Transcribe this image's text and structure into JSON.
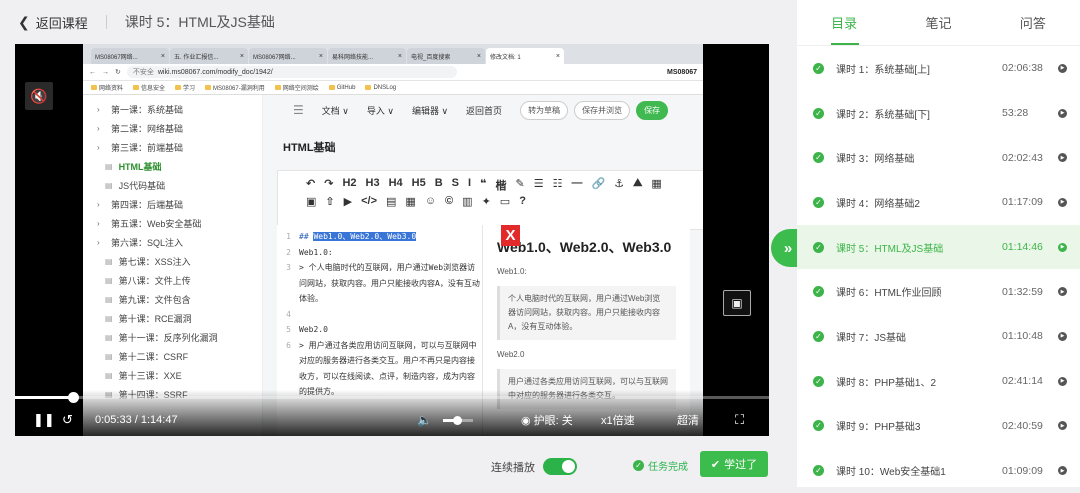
{
  "header": {
    "back_label": "返回课程",
    "lesson_title": "课时 5：HTML及JS基础"
  },
  "browser": {
    "tabs": [
      "MS08067网络...",
      "五. 作业汇报信...",
      "MS08067网络...",
      "易科网络技能...",
      "电视_百度搜索",
      "修改文档: 1"
    ],
    "url_warning": "不安全",
    "url": "wiki.ms08067.com/modify_doc/1942/",
    "bookmarks": [
      "网络资料",
      "信息安全",
      "学习",
      "MS08067-漏洞利用",
      "网络空间测绘",
      "GitHub",
      "DNSLog"
    ],
    "brand": "MS08067"
  },
  "doc_nav": [
    {
      "label": "第一课：系统基础",
      "type": "folder"
    },
    {
      "label": "第二课：网络基础",
      "type": "folder"
    },
    {
      "label": "第三课：前端基础",
      "type": "folder"
    },
    {
      "label": "HTML基础",
      "type": "current"
    },
    {
      "label": "JS代码基础",
      "type": "file"
    },
    {
      "label": "第四课：后端基础",
      "type": "folder"
    },
    {
      "label": "第五课：Web安全基础",
      "type": "folder"
    },
    {
      "label": "第六课：SQL注入",
      "type": "folder"
    },
    {
      "label": "第七课：XSS注入",
      "type": "file"
    },
    {
      "label": "第八课：文件上传",
      "type": "file"
    },
    {
      "label": "第九课：文件包含",
      "type": "file"
    },
    {
      "label": "第十课：RCE漏洞",
      "type": "file"
    },
    {
      "label": "第十一课：反序列化漏洞",
      "type": "file"
    },
    {
      "label": "第十二课：CSRF",
      "type": "file"
    },
    {
      "label": "第十三课：XXE",
      "type": "file"
    },
    {
      "label": "第十四课：SSRF",
      "type": "file"
    }
  ],
  "editor": {
    "menu": [
      "文档 ∨",
      "导入 ∨",
      "编辑器 ∨",
      "返回首页"
    ],
    "draft_label": "转为草稿",
    "save_preview_label": "保存并浏览",
    "save_label": "保存",
    "doc_title": "HTML基础",
    "toolbar_row1": [
      "↶",
      "↷",
      "H2",
      "H3",
      "H4",
      "H5",
      "B",
      "S",
      "I",
      "❝",
      "楷",
      "✎",
      "☰",
      "☷",
      "—",
      "🔗",
      "⚓",
      "⛰",
      "▦"
    ],
    "toolbar_row2": [
      "▣",
      "⇧",
      "▶",
      "</>",
      "▤",
      "▦",
      "☺",
      "©",
      "▥",
      "✦",
      "▭",
      "?"
    ],
    "code_lines": [
      {
        "n": "1",
        "pre": "## ",
        "sel": "Web1.0、Web2.0、Web3.0"
      },
      {
        "n": "2",
        "text": "Web1.0:"
      },
      {
        "n": "3",
        "text": "> 个人电脑时代的互联网，用户通过Web浏览器访问网站，获取内容。用户只能接收内容A，没有互动体验。",
        "green": true
      },
      {
        "n": "4",
        "text": ""
      },
      {
        "n": "5",
        "text": "Web2.0"
      },
      {
        "n": "6",
        "text": "> 用户通过各类应用访问互联网，可以与互联网中对应的服务器进行各类交互。用户不再只是内容接收方，可以在线阅读、点评，制造内容，成为内容的提供方。",
        "green": true
      }
    ],
    "preview_title": "Web1.0、Web2.0、Web3.0",
    "preview_p1": "Web1.0:",
    "preview_quote1": "个人电脑时代的互联网，用户通过Web浏览器访问网站，获取内容。用户只能接收内容A，没有互动体验。",
    "preview_p2": "Web2.0",
    "preview_quote2": "用户通过各类应用访问互联网，可以与互联网中对应的服务器进行各类交互。"
  },
  "player": {
    "progress_fraction": 0.077,
    "time": "0:05:33 / 1:14:47",
    "volume_fraction": 0.45,
    "eye_label": "护眼: 关",
    "speed_label": "x1倍速",
    "quality_label": "超清"
  },
  "bottom": {
    "autoplay_label": "连续播放",
    "task_done_label": "任务完成",
    "learned_label": "学过了"
  },
  "panel": {
    "tabs": [
      "目录",
      "笔记",
      "问答"
    ],
    "lessons": [
      {
        "title": "课时 1：系统基础[上]",
        "duration": "02:06:38"
      },
      {
        "title": "课时 2：系统基础[下]",
        "duration": "53:28"
      },
      {
        "title": "课时 3：网络基础",
        "duration": "02:02:43"
      },
      {
        "title": "课时 4：网络基础2",
        "duration": "01:17:09"
      },
      {
        "title": "课时 5：HTML及JS基础",
        "duration": "01:14:46",
        "current": true
      },
      {
        "title": "课时 6：HTML作业回顾",
        "duration": "01:32:59"
      },
      {
        "title": "课时 7：JS基础",
        "duration": "01:10:48"
      },
      {
        "title": "课时 8：PHP基础1、2",
        "duration": "02:41:14"
      },
      {
        "title": "课时 9：PHP基础3",
        "duration": "02:40:59"
      },
      {
        "title": "课时 10：Web安全基础1",
        "duration": "01:09:09"
      }
    ]
  },
  "colors": {
    "accent": "#3cb449",
    "selection": "#3875d7"
  }
}
